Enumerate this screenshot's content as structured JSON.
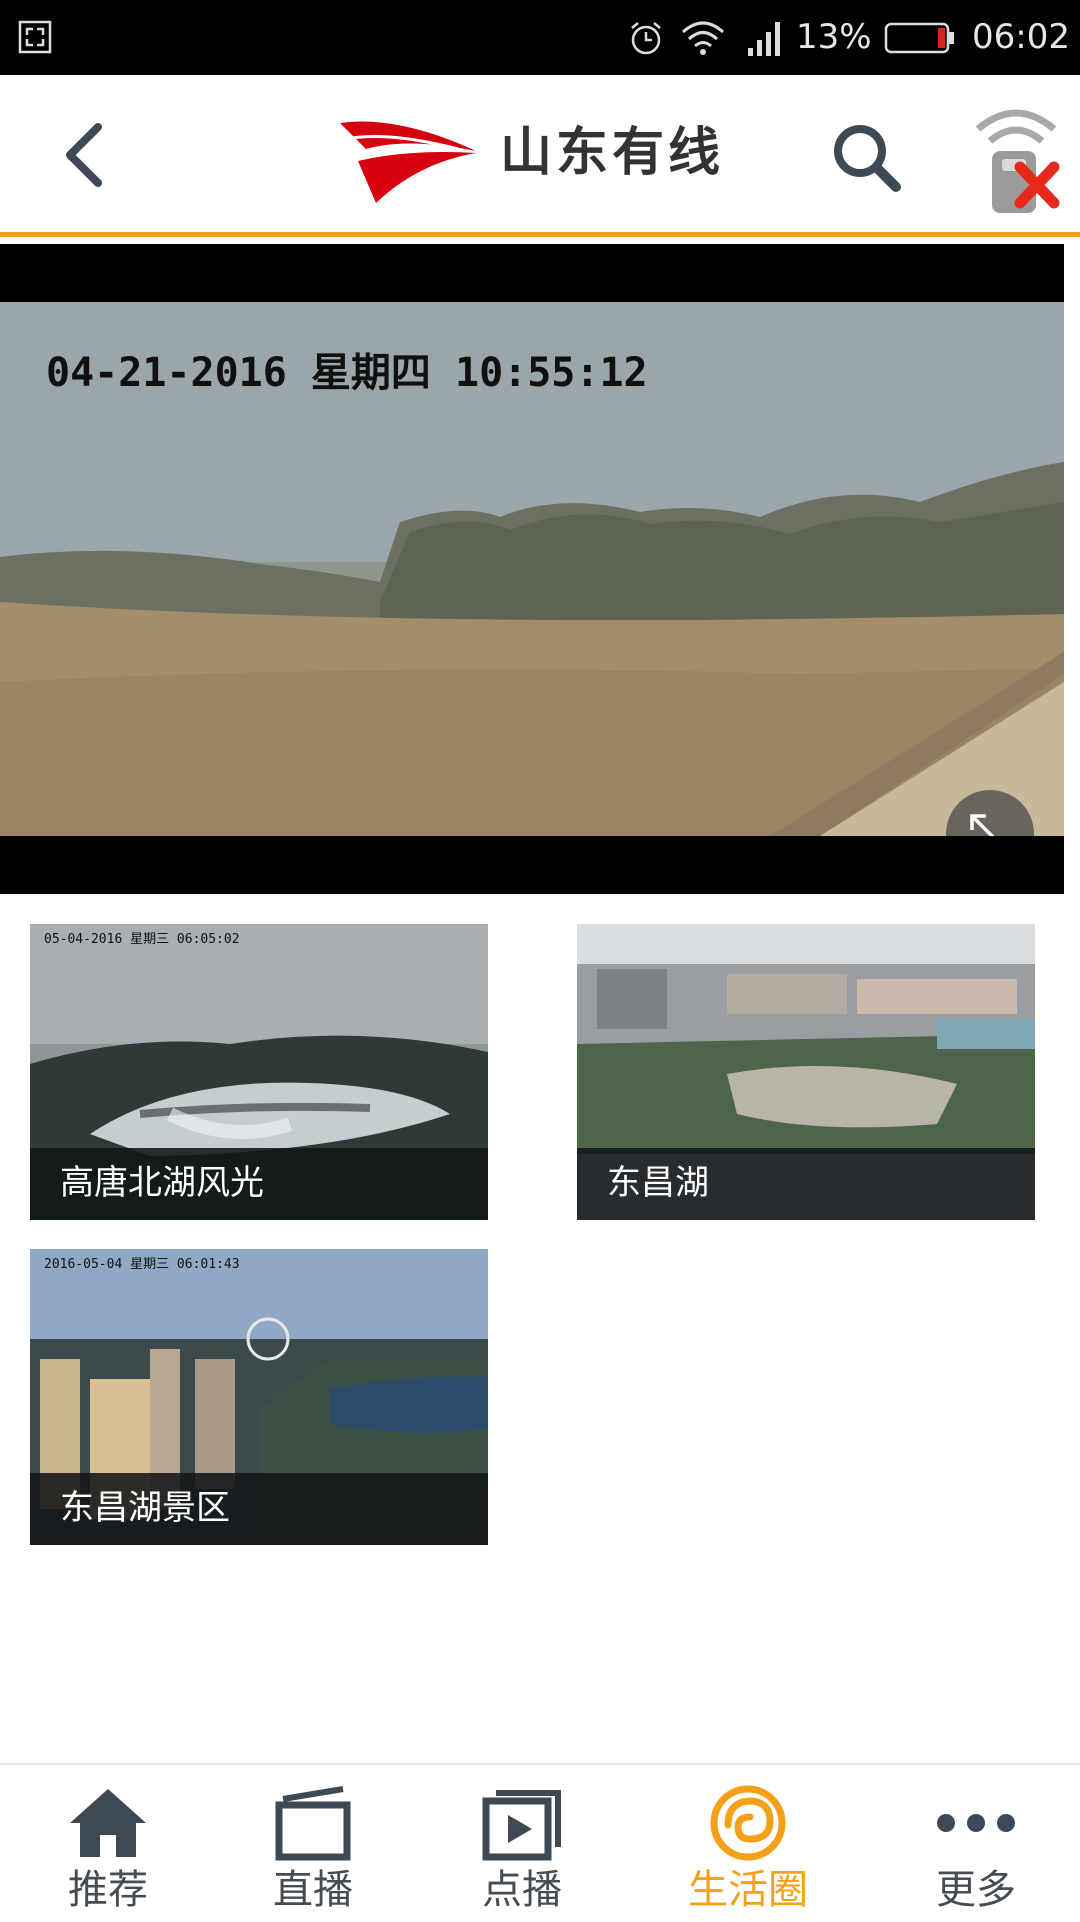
{
  "status_bar": {
    "battery": "13%",
    "time": "06:02",
    "icons": [
      "screenshot-icon",
      "alarm-icon",
      "wifi-icon",
      "signal-icon",
      "battery-icon"
    ]
  },
  "header": {
    "brand": "山东有线",
    "icons": [
      "back-icon",
      "logo-icon",
      "search-icon",
      "remote-disconnected-icon"
    ],
    "accent_color": "#f2a01c",
    "logo_color": "#d7000f"
  },
  "player": {
    "overlay_text": "04-21-2016 星期四 10:55:12",
    "fullscreen_icon": "expand-icon"
  },
  "channels": [
    {
      "title": "高唐北湖风光",
      "stamp": "05-04-2016 星期三 06:05:02"
    },
    {
      "title": "东昌湖",
      "stamp": ""
    },
    {
      "title": "东昌湖景区",
      "stamp": "2016-05-04 星期三 06:01:43"
    }
  ],
  "nav": {
    "active_color": "#f5a018",
    "items": [
      {
        "label": "推荐",
        "icon": "home-icon"
      },
      {
        "label": "直播",
        "icon": "tv-icon"
      },
      {
        "label": "点播",
        "icon": "play-icon"
      },
      {
        "label": "生活圈",
        "icon": "life-circle-icon"
      },
      {
        "label": "更多",
        "icon": "more-icon"
      }
    ]
  }
}
